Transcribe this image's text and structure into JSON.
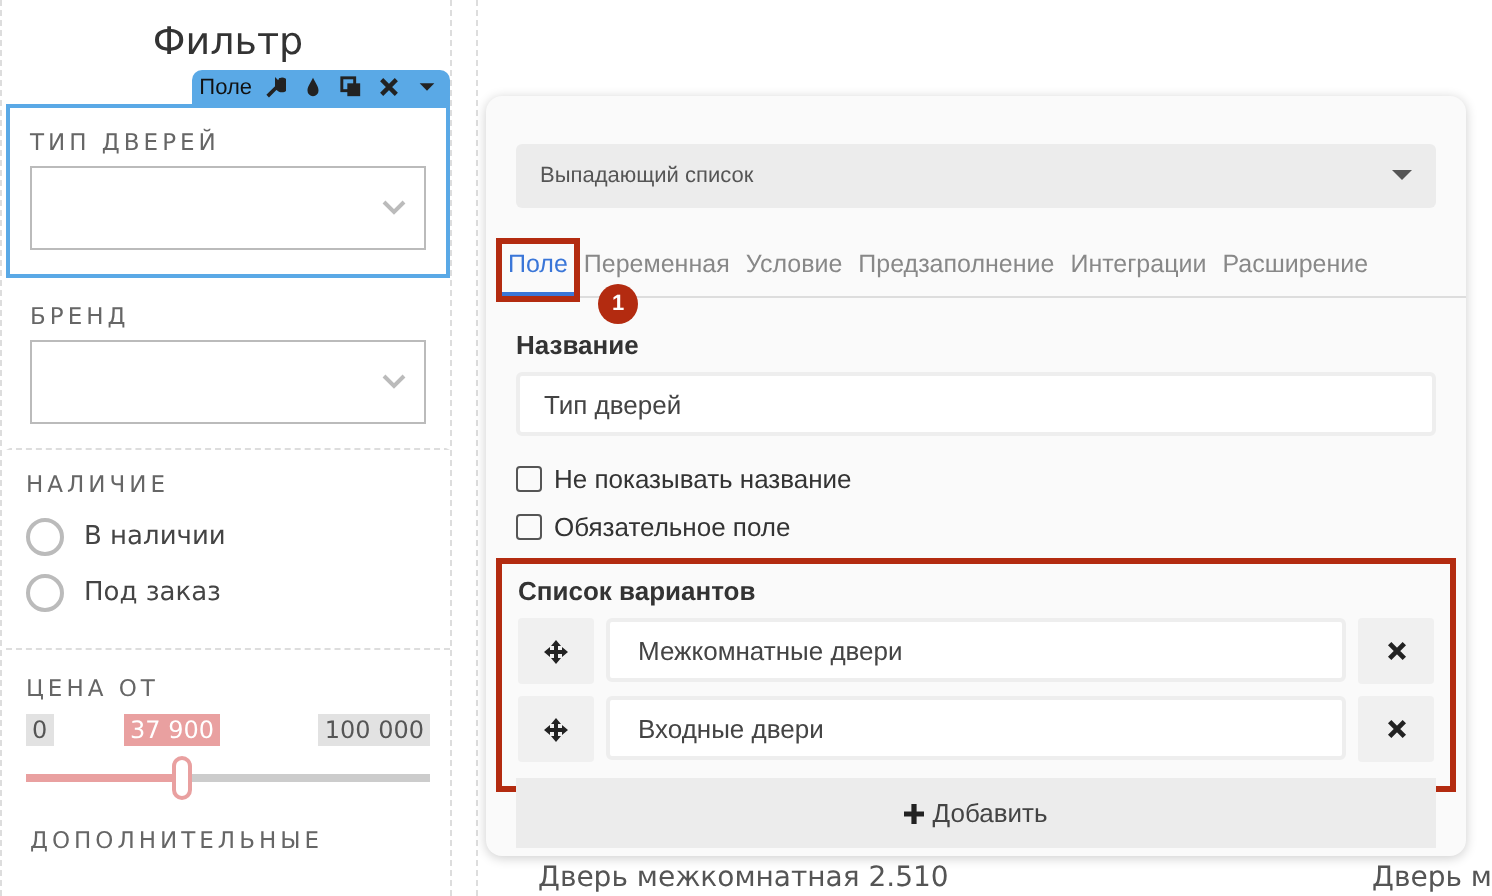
{
  "filter": {
    "title": "Фильтр",
    "toolbar": {
      "label": "Поле"
    },
    "fields": [
      {
        "kind": "select",
        "label": "ТИП ДВЕРЕЙ",
        "selected": true
      },
      {
        "kind": "select",
        "label": "БРЕНД",
        "selected": false
      }
    ],
    "availability": {
      "label": "НАЛИЧИЕ",
      "options": [
        {
          "label": "В наличии",
          "selected": false
        },
        {
          "label": "Под заказ",
          "selected": false
        }
      ]
    },
    "price": {
      "label": "ЦЕНА ОТ",
      "min": "0",
      "value": "37 900",
      "max": "100 000",
      "level": 0.385
    },
    "next_section": "ДОПОЛНИТЕЛЬНЫЕ"
  },
  "products": [
    "Дверь межкомнатная 2.510",
    "Дверь м"
  ],
  "editor": {
    "type_select": "Выпадающий список",
    "tabs": [
      {
        "label": "Поле",
        "selected": true,
        "highlighted": true
      },
      {
        "label": "Переменная",
        "selected": false,
        "highlighted": false
      },
      {
        "label": "Условие",
        "selected": false,
        "highlighted": false
      },
      {
        "label": "Предзаполнение",
        "selected": false,
        "highlighted": false
      },
      {
        "label": "Интеграции",
        "selected": false,
        "highlighted": false
      },
      {
        "label": "Расширение",
        "selected": false,
        "highlighted": false
      }
    ],
    "callout": "1",
    "name_label": "Название",
    "name_value": "Тип дверей",
    "checkboxes": [
      {
        "label": "Не показывать название",
        "checked": false
      },
      {
        "label": "Обязательное поле",
        "checked": false
      }
    ],
    "options_section": {
      "label": "Список вариантов",
      "highlighted": true,
      "options": [
        "Межкомнатные двери",
        "Входные двери"
      ]
    },
    "add_button": "Добавить"
  }
}
